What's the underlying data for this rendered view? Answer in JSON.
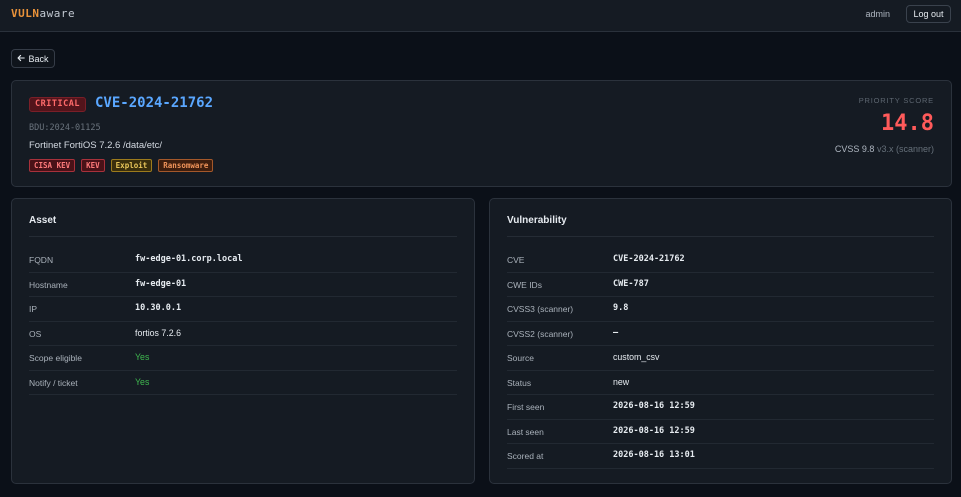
{
  "app": {
    "brand_part1": "VULN",
    "brand_part2": "aware",
    "user": "admin",
    "logout_label": "Log out",
    "back_label": "Back"
  },
  "hero": {
    "severity": "CRITICAL",
    "cve_id": "CVE-2024-21762",
    "bdu_id": "BDU:2024-01125",
    "product": "Fortinet FortiOS 7.2.6 /data/etc/",
    "tags": [
      "CISA KEV",
      "KEV",
      "Exploit",
      "Ransomware"
    ],
    "priority_label": "PRIORITY SCORE",
    "priority_score": "14.8",
    "cvss_text": "CVSS 9.8",
    "cvss_source": "v3.x (scanner)"
  },
  "asset": {
    "title": "Asset",
    "rows": [
      {
        "label": "FQDN",
        "value": "fw-edge-01.corp.local"
      },
      {
        "label": "Hostname",
        "value": "fw-edge-01"
      },
      {
        "label": "IP",
        "value": "10.30.0.1"
      },
      {
        "label": "OS",
        "value": "fortios 7.2.6"
      },
      {
        "label": "Scope eligible",
        "value": "Yes"
      },
      {
        "label": "Notify / ticket",
        "value": "Yes"
      }
    ]
  },
  "vulnerability": {
    "title": "Vulnerability",
    "rows": [
      {
        "label": "CVE",
        "value": "CVE-2024-21762"
      },
      {
        "label": "CWE IDs",
        "value": "CWE-787"
      },
      {
        "label": "CVSS3 (scanner)",
        "value": "9.8"
      },
      {
        "label": "CVSS2 (scanner)",
        "value": "—"
      },
      {
        "label": "Source",
        "value": "custom_csv"
      },
      {
        "label": "Status",
        "value": "new"
      },
      {
        "label": "First seen",
        "value": "2026-08-16 12:59"
      },
      {
        "label": "Last seen",
        "value": "2026-08-16 12:59"
      },
      {
        "label": "Scored at",
        "value": "2026-08-16 13:01"
      }
    ]
  },
  "colors": {
    "brand_accent": "#e8923a",
    "cve_link": "#5aa7ff",
    "score_red": "#ff5a5a",
    "success_green": "#3fb950",
    "background": "#0b1018",
    "card": "#151b23"
  },
  "icons": {
    "back": "arrow-left-icon"
  }
}
